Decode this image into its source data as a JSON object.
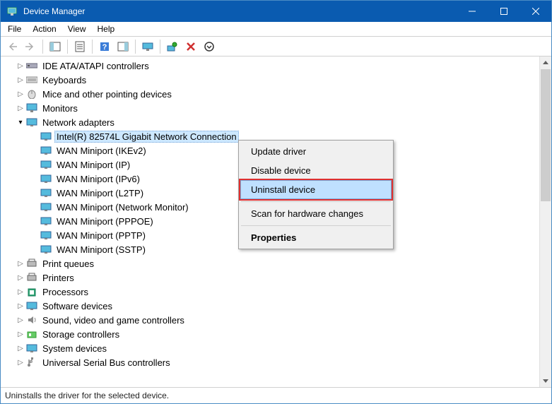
{
  "window": {
    "title": "Device Manager"
  },
  "menubar": {
    "items": [
      "File",
      "Action",
      "View",
      "Help"
    ]
  },
  "toolbar": {
    "back": "Back",
    "forward": "Forward",
    "actions": "Show/hide console tree",
    "properties": "Properties",
    "help": "Help",
    "scan": "Scan for hardware changes",
    "uninstall": "Uninstall device",
    "update": "Update driver"
  },
  "tree": {
    "cat_ide": "IDE ATA/ATAPI controllers",
    "cat_keyboards": "Keyboards",
    "cat_mice": "Mice and other pointing devices",
    "cat_monitors": "Monitors",
    "cat_network": "Network adapters",
    "cat_printqueues": "Print queues",
    "cat_printers": "Printers",
    "cat_processors": "Processors",
    "cat_software": "Software devices",
    "cat_sound": "Sound, video and game controllers",
    "cat_storage": "Storage controllers",
    "cat_system": "System devices",
    "cat_usb": "Universal Serial Bus controllers",
    "net_intel": "Intel(R) 82574L Gigabit Network Connection",
    "net_ikev2": "WAN Miniport (IKEv2)",
    "net_ip": "WAN Miniport (IP)",
    "net_ipv6": "WAN Miniport (IPv6)",
    "net_l2tp": "WAN Miniport (L2TP)",
    "net_netmon": "WAN Miniport (Network Monitor)",
    "net_pppoe": "WAN Miniport (PPPOE)",
    "net_pptp": "WAN Miniport (PPTP)",
    "net_sstp": "WAN Miniport (SSTP)"
  },
  "context_menu": {
    "update": "Update driver",
    "disable": "Disable device",
    "uninstall": "Uninstall device",
    "scan": "Scan for hardware changes",
    "properties": "Properties"
  },
  "statusbar": {
    "text": "Uninstalls the driver for the selected device."
  }
}
